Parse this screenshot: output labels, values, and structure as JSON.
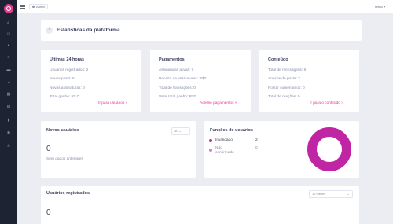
{
  "topbar": {
    "admin_label": "Admin",
    "user_label": "Menu ▾"
  },
  "sidebar": {
    "icons": [
      "home-icon",
      "folder-icon",
      "user-icon",
      "list-icon",
      "card-icon",
      "share-icon",
      "grid-icon",
      "chart-icon",
      "file-icon",
      "users-icon",
      "settings-icon"
    ]
  },
  "page": {
    "title": "Estatísticas da plataforma"
  },
  "cards": {
    "last24": {
      "title": "Últimas 24 horas",
      "lines": [
        "Usuários registrados: 2",
        "Novos posts: 6",
        "Novas assinaturas: 0",
        "Total ganho: R$ 0"
      ],
      "link": "Ir para usuários »"
    },
    "payments": {
      "title": "Pagamentos",
      "lines": [
        "Assinaturas ativas: 0",
        "Receita de assinaturas: R$0",
        "Total de transações: 0",
        "Valor total ganho: R$0"
      ],
      "link": "Acesse pagamentos »"
    },
    "content": {
      "title": "Conteúdo",
      "lines": [
        "Total de mensagens: 6",
        "Anexos de posts: 2",
        "Postar comentários: 0",
        "Total de reações: 0"
      ],
      "link": "Ir para o conteúdo »"
    }
  },
  "new_users": {
    "title": "Novos usuários",
    "select_value": "30 ⌄",
    "count": "0",
    "subtitle": "Sem dados anteriores"
  },
  "roles": {
    "title": "Funções de usuários",
    "items": [
      {
        "label": "Invalidado",
        "value": "2",
        "color": "#c026a3"
      },
      {
        "label": "Não confirmado",
        "value": "0",
        "color": "#e879c9"
      }
    ]
  },
  "registered": {
    "title": "Usuários registrados",
    "select_value": "12 meses",
    "count": "0"
  }
}
